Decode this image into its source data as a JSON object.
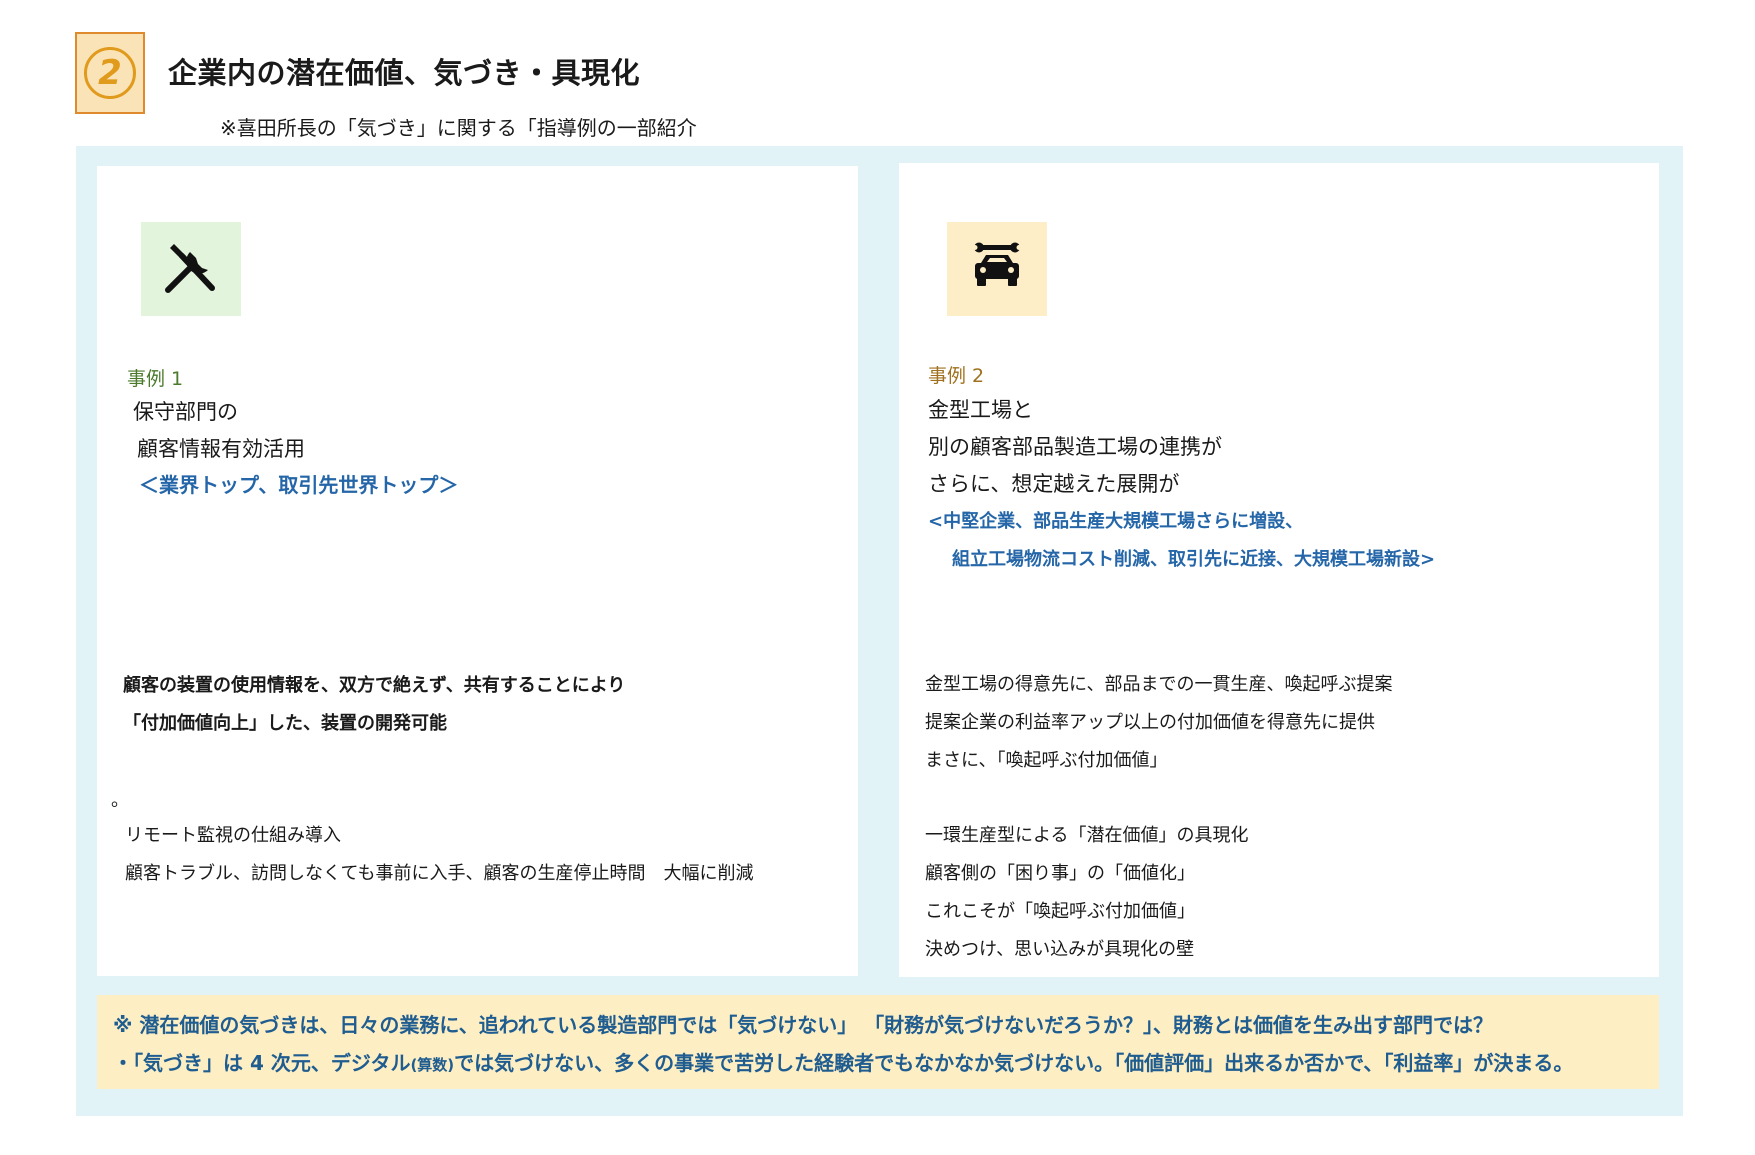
{
  "header": {
    "badge_number": "2",
    "title": "企業内の潜在価値、気づき・具現化",
    "subtitle": "※喜田所長の「気づき」に関する「指導例の一部紹介"
  },
  "case1": {
    "icon": "tools-icon",
    "label": "事例 1",
    "heading_lines": [
      "保守部門の",
      "顧客情報有効活用"
    ],
    "highlight": "＜業界トップ、取引先世界トップ＞",
    "bold_lines": [
      "顧客の装置の使用情報を、双方で絶えず、共有することにより",
      "「付加価値向上」した、装置の開発可能"
    ],
    "dot": "。",
    "detail_lines": [
      "リモート監視の仕組み導入",
      "顧客トラブル、訪問しなくても事前に入手、顧客の生産停止時間　大幅に削減"
    ]
  },
  "case2": {
    "icon": "car-repair-icon",
    "label": "事例 2",
    "heading_lines": [
      "金型工場と",
      "別の顧客部品製造工場の連携が",
      "さらに、想定越えた展開が"
    ],
    "highlight_lines": [
      "<中堅企業、部品生産大規模工場さらに増設、",
      "組立工場物流コスト削減、取引先に近接、大規模工場新設>"
    ],
    "detail_lines_a": [
      "金型工場の得意先に、部品までの一貫生産、喚起呼ぶ提案",
      "提案企業の利益率アップ以上の付加価値を得意先に提供",
      "まさに、「喚起呼ぶ付加価値」"
    ],
    "detail_lines_b": [
      "一環生産型による「潜在価値」の具現化",
      "顧客側の「困り事」の「価値化」",
      "これこそが「喚起呼ぶ付加価値」",
      "決めつけ、思い込みが具現化の壁"
    ]
  },
  "note": {
    "line1": "※ 潜在価値の気づきは、日々の業務に、追われている製造部門では「気づけない」 「財務が気づけないだろうか？」、財務とは価値を生み出す部門では？",
    "line2_a": "・「気づき」は 4 次元、デジタル",
    "line2_small": "(算数)",
    "line2_b": "では気づけない、多くの事業で苦労した経験者でもなかなか気づけない。「価値評価」出来るか否かで、「利益率」が決まる。"
  },
  "colors": {
    "accent_orange": "#e09a1c",
    "panel_blue": "#e2f3f8",
    "text_blue": "#2566a8",
    "note_bg": "#fdeec4"
  }
}
